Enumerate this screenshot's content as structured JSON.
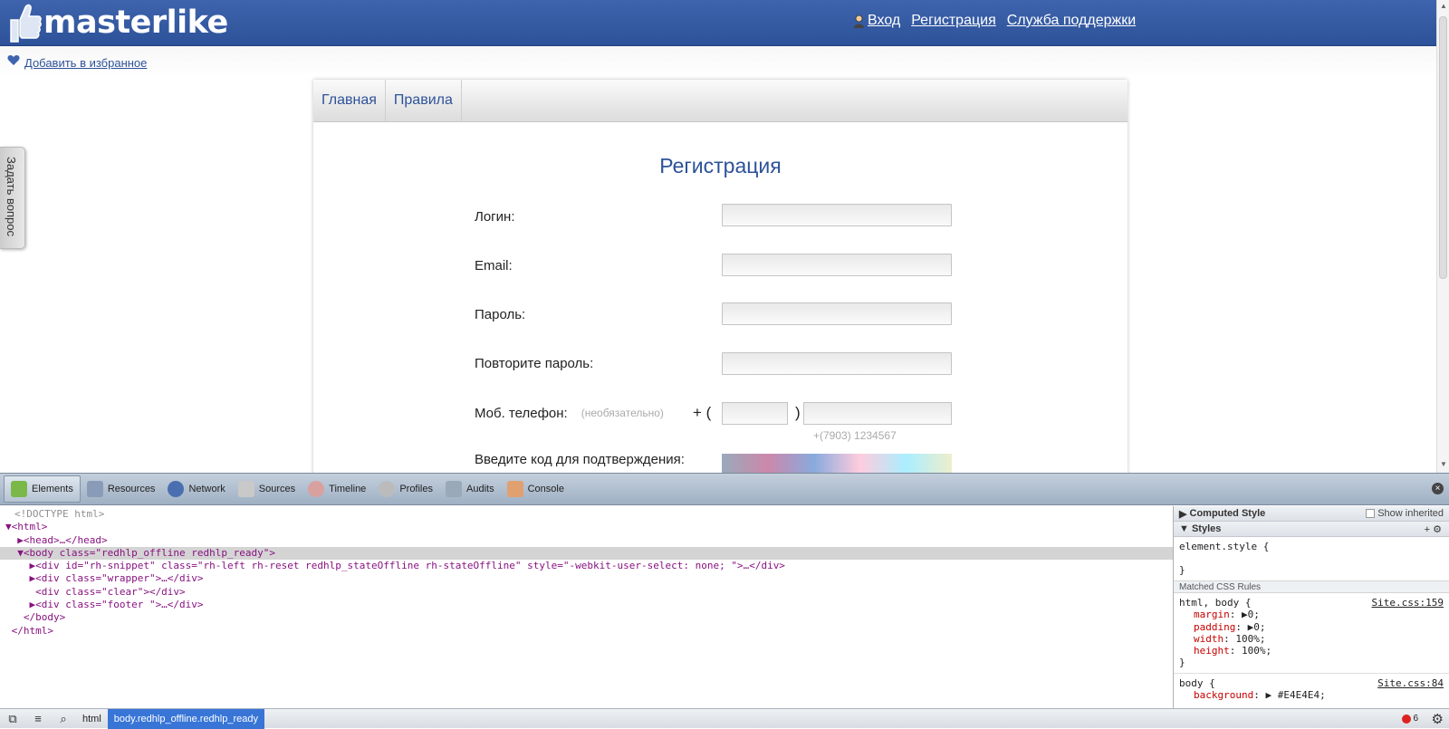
{
  "site": {
    "logo_text": "masterlike",
    "top_links": {
      "login": "Вход",
      "register": "Регистрация",
      "support": "Служба поддержки"
    },
    "favorites_link": "Добавить в избранное",
    "ask_tab": "Задать вопрос",
    "nav": [
      "Главная",
      "Правила"
    ],
    "form": {
      "title": "Регистрация",
      "login_label": "Логин:",
      "email_label": "Email:",
      "password_label": "Пароль:",
      "password_repeat_label": "Повторите пароль:",
      "phone_label": "Моб. телефон:",
      "phone_optional": "(необязательно)",
      "phone_prefix": "+ (",
      "phone_paren": ")",
      "phone_hint": "+(7903) 1234567",
      "captcha_label": "Введите код для подтверждения:"
    }
  },
  "devtools": {
    "tabs": [
      "Elements",
      "Resources",
      "Network",
      "Sources",
      "Timeline",
      "Profiles",
      "Audits",
      "Console"
    ],
    "active_tab": "Elements",
    "dom_lines": [
      "<!DOCTYPE html>",
      "▼<html>",
      "  ▶<head>…</head>",
      "  ▼<body class=\"redhlp_offline redhlp_ready\">",
      "    ▶<div id=\"rh-snippet\" class=\"rh-left rh-reset redhlp_stateOffline rh-stateOffline\" style=\"-webkit-user-select: none; \">…</div>",
      "    ▶<div class=\"wrapper\">…</div>",
      "     <div class=\"clear\"></div>",
      "    ▶<div class=\"footer \">…</div>",
      "   </body>",
      " </html>"
    ],
    "computed_style": "Computed Style",
    "show_inherited": "Show inherited",
    "styles": "Styles",
    "element_style": "element.style {",
    "close_brace": "}",
    "matched_rules": "Matched CSS Rules",
    "rule1": {
      "selector": "html, body {",
      "source": "Site.css:159",
      "decls": [
        [
          "margin",
          "▶0;"
        ],
        [
          "padding",
          "▶0;"
        ],
        [
          "width",
          "100%;"
        ],
        [
          "height",
          "100%;"
        ]
      ]
    },
    "rule2": {
      "selector": "body {",
      "source": "Site.css:84",
      "decls": [
        [
          "background",
          "▶ #E4E4E4;"
        ]
      ]
    },
    "breadcrumbs": [
      "html",
      "body.redhlp_offline.redhlp_ready"
    ],
    "error_count": "6"
  },
  "colors": {
    "header_blue": "#2d5299",
    "accent_link": "#2d5299",
    "selection": "#3875d7"
  }
}
